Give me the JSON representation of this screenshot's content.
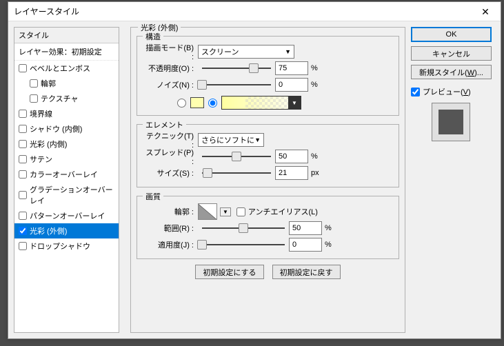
{
  "dialog": {
    "title": "レイヤースタイル"
  },
  "styles": {
    "header": "スタイル",
    "layer_effect": "レイヤー効果：初期設定",
    "items": [
      {
        "label": "ベベルとエンボス",
        "indent": false,
        "checked": false
      },
      {
        "label": "輪郭",
        "indent": true,
        "checked": false
      },
      {
        "label": "テクスチャ",
        "indent": true,
        "checked": false
      },
      {
        "label": "境界線",
        "indent": false,
        "checked": false
      },
      {
        "label": "シャドウ (内側)",
        "indent": false,
        "checked": false
      },
      {
        "label": "光彩 (内側)",
        "indent": false,
        "checked": false
      },
      {
        "label": "サテン",
        "indent": false,
        "checked": false
      },
      {
        "label": "カラーオーバーレイ",
        "indent": false,
        "checked": false
      },
      {
        "label": "グラデーションオーバーレイ",
        "indent": false,
        "checked": false
      },
      {
        "label": "パターンオーバーレイ",
        "indent": false,
        "checked": false
      },
      {
        "label": "光彩 (外側)",
        "indent": false,
        "checked": true,
        "selected": true
      },
      {
        "label": "ドロップシャドウ",
        "indent": false,
        "checked": false
      }
    ]
  },
  "panel": {
    "title": "光彩 (外側)",
    "structure": {
      "title": "構造",
      "blend_label": "描画モード(B) :",
      "blend_value": "スクリーン",
      "opacity_label": "不透明度(O) :",
      "opacity_value": "75",
      "opacity_unit": "%",
      "noise_label": "ノイズ(N) :",
      "noise_value": "0",
      "noise_unit": "%",
      "color_hex": "#ffffb0"
    },
    "element": {
      "title": "エレメント",
      "technique_label": "テクニック(T) :",
      "technique_value": "さらにソフトに",
      "spread_label": "スプレッド(P) :",
      "spread_value": "50",
      "spread_unit": "%",
      "size_label": "サイズ(S) :",
      "size_value": "21",
      "size_unit": "px"
    },
    "quality": {
      "title": "画質",
      "contour_label": "輪郭 :",
      "antialias_label": "アンチエイリアス(L)",
      "range_label": "範囲(R) :",
      "range_value": "50",
      "range_unit": "%",
      "jitter_label": "適用度(J) :",
      "jitter_value": "0",
      "jitter_unit": "%"
    },
    "reset_default": "初期設定にする",
    "reset_revert": "初期設定に戻す"
  },
  "right": {
    "ok": "OK",
    "cancel": "キャンセル",
    "new_style": "新規スタイル(W)...",
    "preview_label": "プレビュー(V)"
  },
  "chart_data": {
    "type": "table",
    "title": "Outer Glow layer style parameters",
    "rows": [
      {
        "param": "Blend Mode",
        "value": "Screen"
      },
      {
        "param": "Opacity",
        "value": 75,
        "unit": "%"
      },
      {
        "param": "Noise",
        "value": 0,
        "unit": "%"
      },
      {
        "param": "Technique",
        "value": "Softer"
      },
      {
        "param": "Spread",
        "value": 50,
        "unit": "%"
      },
      {
        "param": "Size",
        "value": 21,
        "unit": "px"
      },
      {
        "param": "Range",
        "value": 50,
        "unit": "%"
      },
      {
        "param": "Jitter",
        "value": 0,
        "unit": "%"
      }
    ]
  }
}
